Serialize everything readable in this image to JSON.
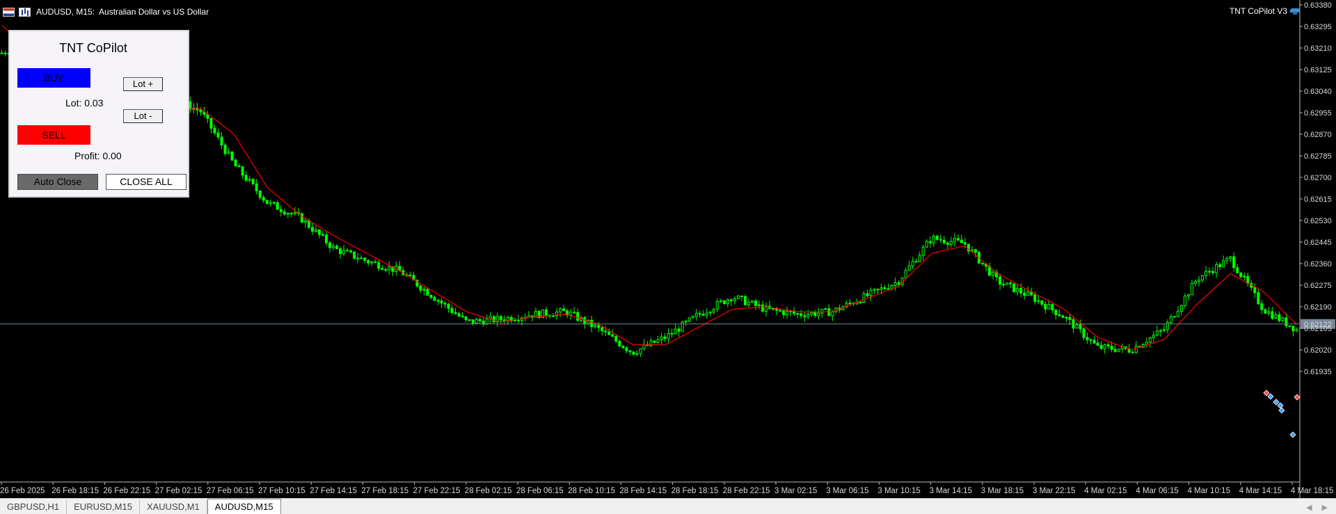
{
  "header": {
    "symbol": "AUDUSD, M15:",
    "description": "Australian Dollar vs US Dollar",
    "ea_name": "TNT CoPilot V3",
    "flag_icon": "calendar-flag-icon",
    "chart_icon": "chart-bars-icon",
    "ea_icon": "graduation-cap-icon"
  },
  "panel": {
    "title": "TNT CoPilot",
    "buy_label": "BUY",
    "sell_label": "SELL",
    "lot_plus_label": "Lot +",
    "lot_minus_label": "Lot -",
    "lot_text": "Lot: 0.03",
    "profit_text": "Profit: 0.00",
    "auto_close_label": "Auto Close",
    "close_all_label": "CLOSE ALL",
    "buy_color": "#0000ff",
    "sell_color": "#ff0000"
  },
  "price_axis": {
    "labels": [
      "0.63380",
      "0.63295",
      "0.63210",
      "0.63125",
      "0.63040",
      "0.62955",
      "0.62870",
      "0.62785",
      "0.62700",
      "0.62615",
      "0.62530",
      "0.62445",
      "0.62360",
      "0.62275",
      "0.62190",
      "0.62105",
      "0.62020",
      "0.61935"
    ],
    "current_price": "0.62122"
  },
  "time_axis": {
    "labels": [
      "26 Feb 2025",
      "26 Feb 18:15",
      "26 Feb 22:15",
      "27 Feb 02:15",
      "27 Feb 06:15",
      "27 Feb 10:15",
      "27 Feb 14:15",
      "27 Feb 18:15",
      "27 Feb 22:15",
      "28 Feb 02:15",
      "28 Feb 06:15",
      "28 Feb 10:15",
      "28 Feb 14:15",
      "28 Feb 18:15",
      "28 Feb 22:15",
      "3 Mar 02:15",
      "3 Mar 06:15",
      "3 Mar 10:15",
      "3 Mar 14:15",
      "3 Mar 18:15",
      "3 Mar 22:15",
      "4 Mar 02:15",
      "4 Mar 06:15",
      "4 Mar 10:15",
      "4 Mar 14:15",
      "4 Mar 18:15"
    ]
  },
  "tabs": [
    {
      "label": "GBPUSD,H1"
    },
    {
      "label": "EURUSD,M15"
    },
    {
      "label": "XAUUSD,M1"
    },
    {
      "label": "AUDUSD,M15"
    }
  ],
  "colors": {
    "candle": "#00ff00",
    "moving_average": "#ff0000",
    "price_line": "#778899"
  },
  "chart_data": {
    "type": "line",
    "series": [
      {
        "values": [
          0.6319,
          0.6324,
          0.6308,
          0.6298,
          0.629,
          0.6302,
          0.6296,
          0.6275,
          0.626,
          0.6254,
          0.6242,
          0.6237,
          0.6233,
          0.6223,
          0.6213,
          0.6214,
          0.6216,
          0.6217,
          0.621,
          0.6201,
          0.6207,
          0.6216,
          0.6223,
          0.6218,
          0.6216,
          0.6217,
          0.6223,
          0.6229,
          0.6246,
          0.6244,
          0.6229,
          0.6223,
          0.6215,
          0.6203,
          0.6202,
          0.621,
          0.623,
          0.6238,
          0.6218,
          0.621
        ]
      },
      {
        "values": [
          0.633,
          0.6318,
          0.6306,
          0.6298,
          0.6292,
          0.6297,
          0.6297,
          0.6287,
          0.6266,
          0.6255,
          0.6247,
          0.624,
          0.6233,
          0.6225,
          0.6217,
          0.6213,
          0.6215,
          0.6216,
          0.6212,
          0.6204,
          0.6204,
          0.6211,
          0.6218,
          0.6219,
          0.6217,
          0.6217,
          0.6222,
          0.6227,
          0.624,
          0.6243,
          0.6232,
          0.6225,
          0.6218,
          0.6207,
          0.6202,
          0.6206,
          0.622,
          0.6232,
          0.6225,
          0.6212
        ]
      }
    ],
    "current_price": 0.62122,
    "ylim": [
      0.619,
      0.634
    ],
    "grid": false,
    "legend": "none"
  }
}
